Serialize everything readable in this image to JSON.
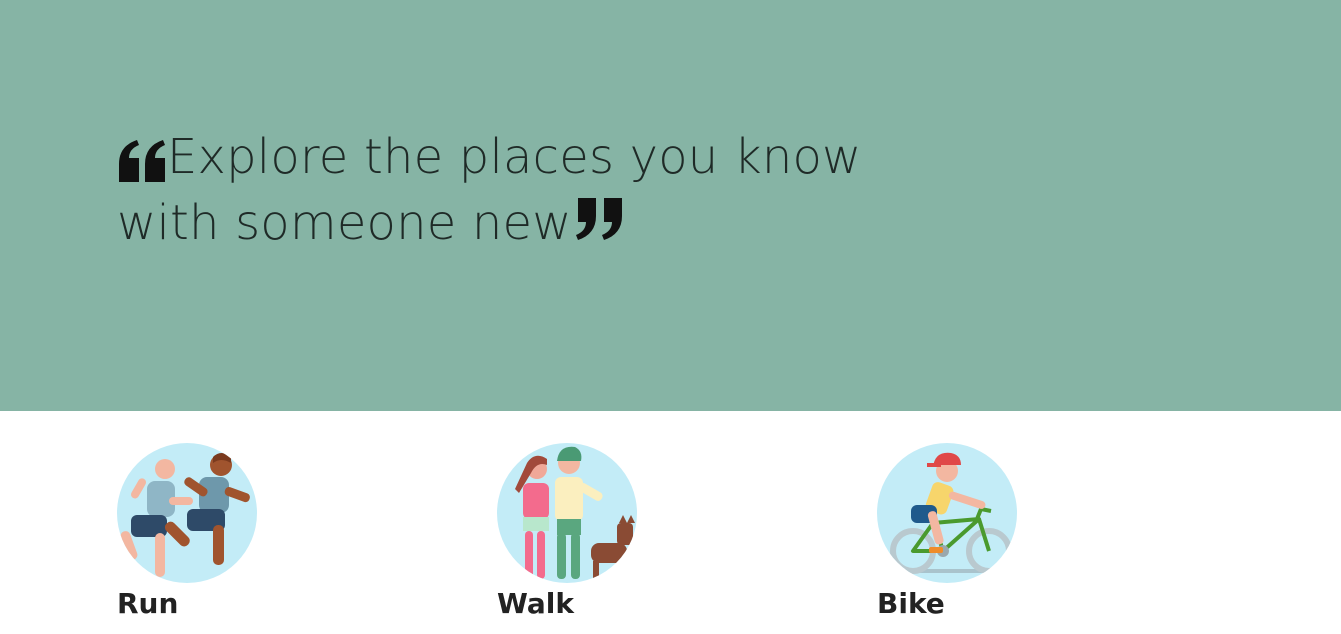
{
  "hero": {
    "quote_line1": "Explore the places you know",
    "quote_line2": "with someone new",
    "background_color": "#86b4a5",
    "open_quote_icon": "open-quote-icon",
    "close_quote_icon": "close-quote-icon"
  },
  "activities": [
    {
      "label": "Run",
      "icon": "runners-icon"
    },
    {
      "label": "Walk",
      "icon": "walkers-with-dog-icon"
    },
    {
      "label": "Bike",
      "icon": "cyclist-icon"
    }
  ],
  "colors": {
    "icon_circle": "#c3ecf7",
    "text": "#222222"
  }
}
